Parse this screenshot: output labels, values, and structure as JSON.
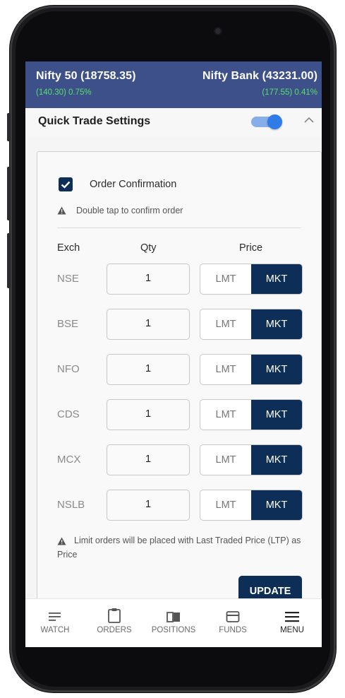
{
  "ticker": {
    "left": {
      "name": "Nifty 50 (18758.35)",
      "change": "(140.30) 0.75%"
    },
    "right": {
      "name": "Nifty Bank (43231.00)",
      "change": "(177.55) 0.41%"
    },
    "change_color": "#55e06b",
    "bg_color": "#3e5089"
  },
  "quick_trade": {
    "title": "Quick Trade Settings",
    "toggle_on": true
  },
  "settings": {
    "order_confirmation_label": "Order Confirmation",
    "order_confirmation_checked": true,
    "double_tap_hint": "Double tap to confirm order",
    "headers": {
      "exch": "Exch",
      "qty": "Qty",
      "price": "Price"
    },
    "rows": [
      {
        "exch": "NSE",
        "qty": "1",
        "lmt": "LMT",
        "mkt": "MKT",
        "selected": "MKT"
      },
      {
        "exch": "BSE",
        "qty": "1",
        "lmt": "LMT",
        "mkt": "MKT",
        "selected": "MKT"
      },
      {
        "exch": "NFO",
        "qty": "1",
        "lmt": "LMT",
        "mkt": "MKT",
        "selected": "MKT"
      },
      {
        "exch": "CDS",
        "qty": "1",
        "lmt": "LMT",
        "mkt": "MKT",
        "selected": "MKT"
      },
      {
        "exch": "MCX",
        "qty": "1",
        "lmt": "LMT",
        "mkt": "MKT",
        "selected": "MKT"
      },
      {
        "exch": "NSLB",
        "qty": "1",
        "lmt": "LMT",
        "mkt": "MKT",
        "selected": "MKT"
      }
    ],
    "limit_note": "Limit orders will be placed with Last Traded Price (LTP) as Price",
    "update_label": "UPDATE",
    "accent_color": "#0d2f57"
  },
  "nav": {
    "items": [
      {
        "label": "WATCH",
        "icon": "watchlist-icon",
        "active": false
      },
      {
        "label": "ORDERS",
        "icon": "clipboard-icon",
        "active": false
      },
      {
        "label": "POSITIONS",
        "icon": "book-icon",
        "active": false
      },
      {
        "label": "FUNDS",
        "icon": "wallet-icon",
        "active": false
      },
      {
        "label": "MENU",
        "icon": "menu-icon",
        "active": true
      }
    ]
  }
}
